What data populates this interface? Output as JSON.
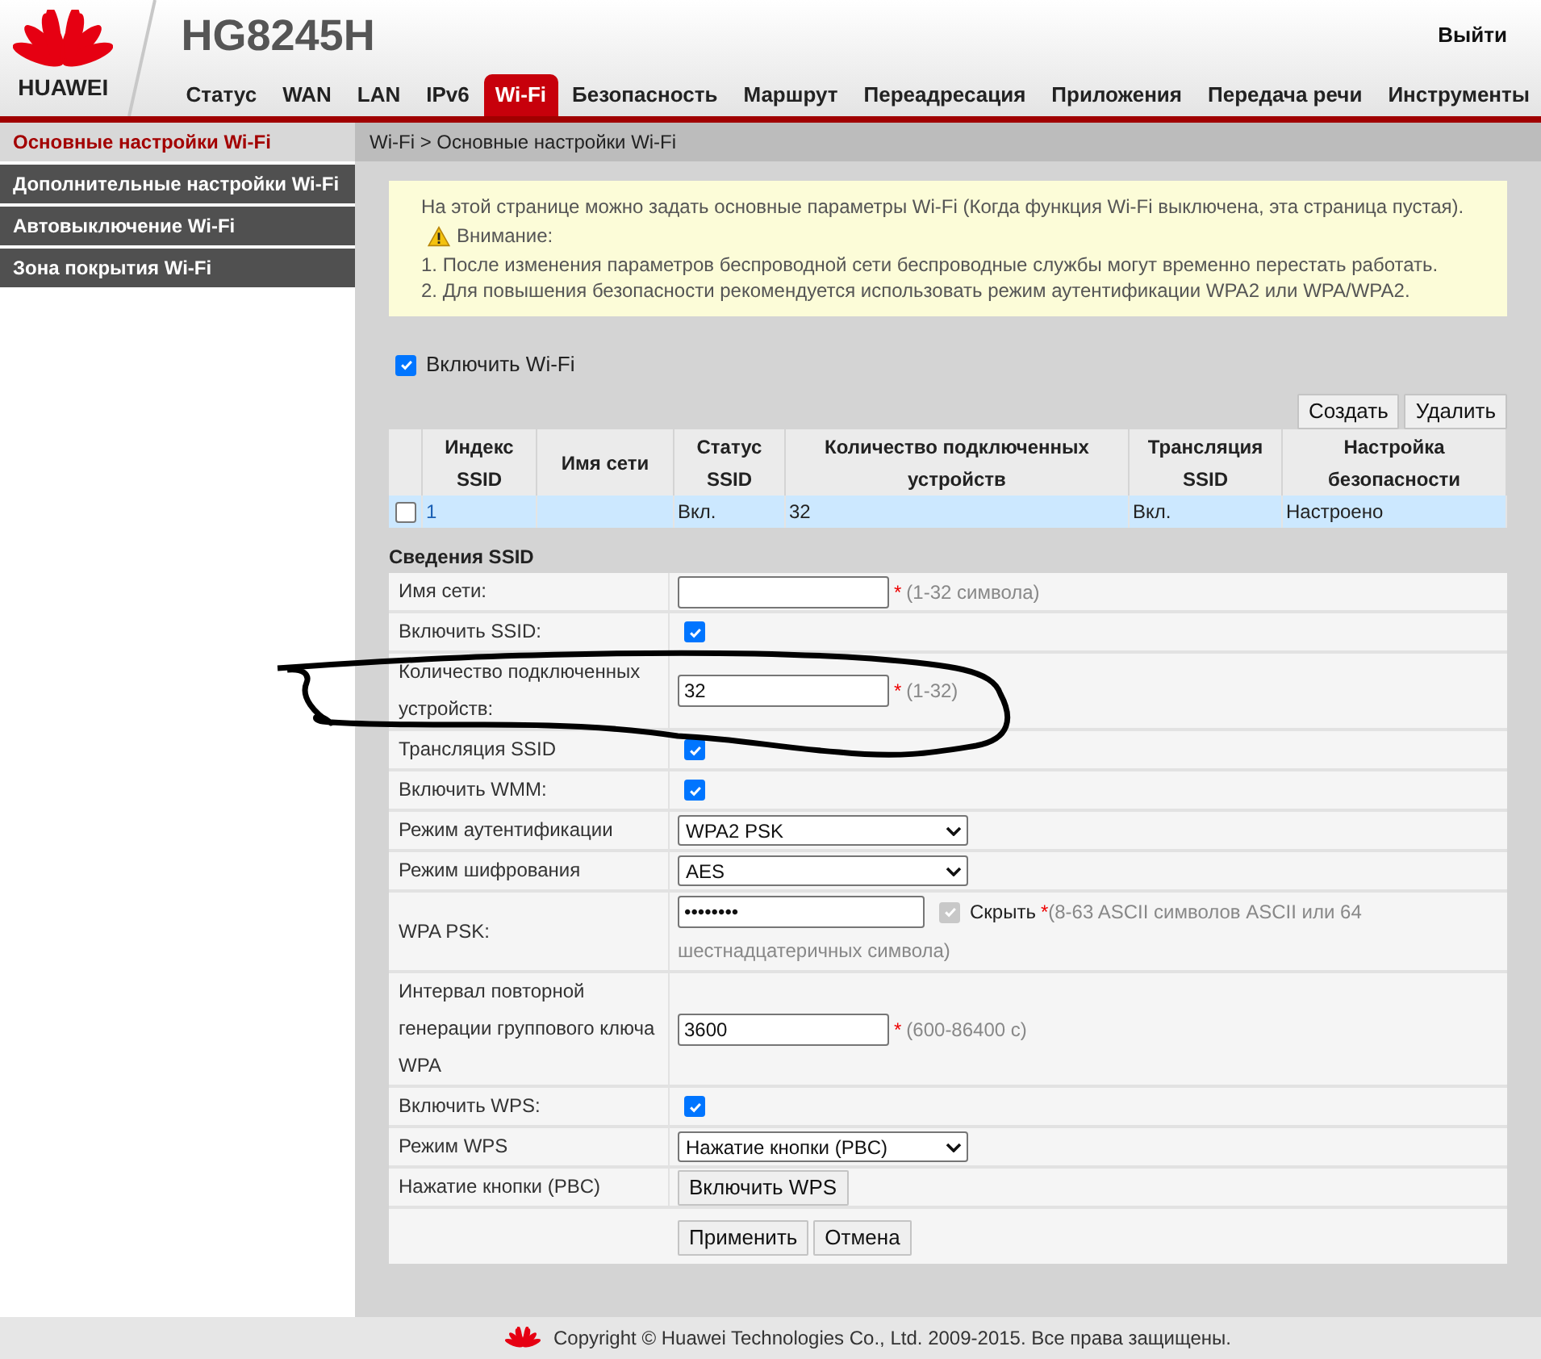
{
  "header": {
    "brand": "HUAWEI",
    "model": "HG8245H",
    "logout": "Выйти"
  },
  "nav": [
    {
      "label": "Статус",
      "selected": false
    },
    {
      "label": "WAN",
      "selected": false
    },
    {
      "label": "LAN",
      "selected": false
    },
    {
      "label": "IPv6",
      "selected": false
    },
    {
      "label": "Wi-Fi",
      "selected": true
    },
    {
      "label": "Безопасность",
      "selected": false
    },
    {
      "label": "Маршрут",
      "selected": false
    },
    {
      "label": "Переадресация",
      "selected": false
    },
    {
      "label": "Приложения",
      "selected": false
    },
    {
      "label": "Передача речи",
      "selected": false
    },
    {
      "label": "Инструменты",
      "selected": false
    }
  ],
  "sidebar": [
    {
      "label": "Основные настройки Wi-Fi",
      "selected": true
    },
    {
      "label": "Дополнительные настройки Wi-Fi",
      "selected": false
    },
    {
      "label": "Автовыключение Wi-Fi",
      "selected": false
    },
    {
      "label": "Зона покрытия Wi-Fi",
      "selected": false
    }
  ],
  "breadcrumb": "Wi-Fi > Основные настройки Wi-Fi",
  "notice": {
    "intro": "На этой странице можно задать основные параметры Wi-Fi (Когда функция Wi-Fi выключена, эта страница пустая).",
    "warning_title": "Внимание:",
    "items": [
      "1. После изменения параметров беспроводной сети беспроводные службы могут временно перестать работать.",
      "2. Для повышения безопасности рекомендуется использовать режим аутентификации WPA2 или WPA/WPA2."
    ]
  },
  "enable_wifi": {
    "label": "Включить Wi-Fi",
    "checked": true
  },
  "table_buttons": [
    "Создать",
    "Удалить"
  ],
  "ssid_table": {
    "columns": [
      "Индекс SSID",
      "Имя сети",
      "Статус SSID",
      "Количество подключенных устройств",
      "Трансляция SSID",
      "Настройка безопасности"
    ],
    "rows": [
      {
        "checked": false,
        "selected": true,
        "cells": [
          "1",
          "",
          "Вкл.",
          "32",
          "Вкл.",
          "Настроено"
        ]
      }
    ]
  },
  "ssid_details": {
    "title": "Сведения SSID",
    "rows": [
      {
        "kind": "input",
        "label": "Имя сети:",
        "value": "",
        "mark": "*",
        "hint": "(1-32 символа)"
      },
      {
        "kind": "checkbox",
        "label": "Включить SSID:",
        "checked": true
      },
      {
        "kind": "input",
        "label": "Количество подключенных устройств:",
        "value": "32",
        "mark": "*",
        "hint": "(1-32)"
      },
      {
        "kind": "checkbox",
        "label": "Трансляция SSID",
        "checked": true
      },
      {
        "kind": "checkbox",
        "label": "Включить WMM:",
        "checked": true
      },
      {
        "kind": "select",
        "label": "Режим аутентификации",
        "value": "WPA2 PSK"
      },
      {
        "kind": "select",
        "label": "Режим шифрования",
        "value": "AES"
      },
      {
        "kind": "password",
        "label": "WPA PSK:",
        "value": "••••••••",
        "hide_label": "Скрыть",
        "hide_checked": true,
        "mark": "*",
        "hint_lines": [
          "(8-63 ASCII символов ASCII или 64",
          "шестнадцатеричных символа)"
        ]
      },
      {
        "kind": "input",
        "label": "Интервал повторной генерации группового ключа WPA",
        "value": "3600",
        "mark": "*",
        "hint": "(600-86400 с)"
      },
      {
        "kind": "checkbox",
        "label": "Включить WPS:",
        "checked": true
      },
      {
        "kind": "select",
        "label": "Режим WPS",
        "value": "Нажатие кнопки (PBC)"
      },
      {
        "kind": "button",
        "label": "Нажатие кнопки (PBC)",
        "value": "Включить WPS"
      }
    ]
  },
  "actions": [
    "Применить",
    "Отмена"
  ],
  "footer": "Copyright © Huawei Technologies Co., Ltd. 2009-2015. Все права защищены."
}
